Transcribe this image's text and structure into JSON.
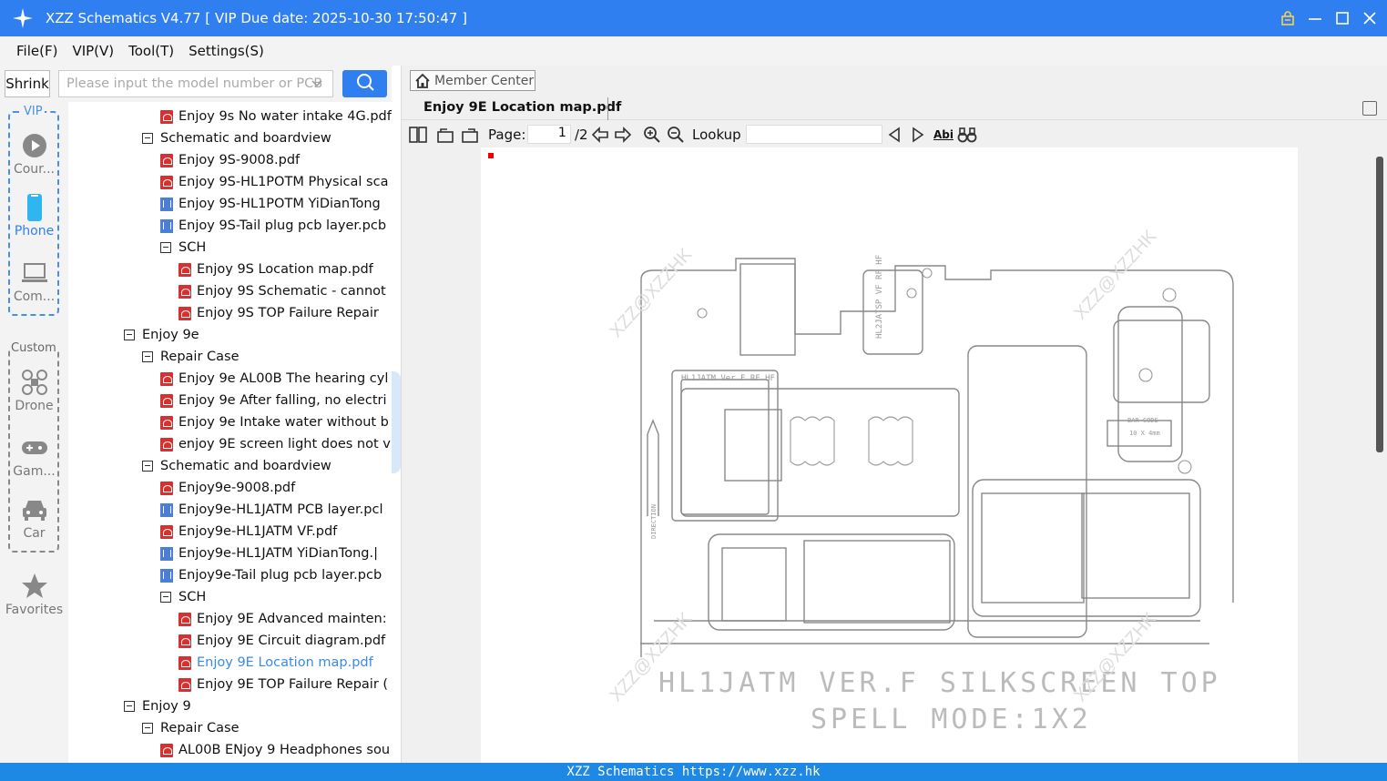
{
  "titlebar": {
    "title": "XZZ Schematics V4.77 [ VIP Due date: 2025-10-30 17:50:47 ]"
  },
  "menu": [
    "File(F)",
    "VIP(V)",
    "Tool(T)",
    "Settings(S)"
  ],
  "search": {
    "shrink_label": "Shrink",
    "placeholder": "Please input the model number or PCB"
  },
  "rail": {
    "vip_tag": "VIP",
    "custom_tag": "Custom",
    "items": [
      {
        "label": "Cour...",
        "icon": "play-icon"
      },
      {
        "label": "Phone",
        "icon": "phone-icon"
      },
      {
        "label": "Com...",
        "icon": "laptop-icon"
      },
      {
        "label": "Drone",
        "icon": "drone-icon"
      },
      {
        "label": "Gam...",
        "icon": "gamepad-icon"
      },
      {
        "label": "Car",
        "icon": "car-icon"
      },
      {
        "label": "Favorites",
        "icon": "star-icon"
      }
    ]
  },
  "tree": [
    {
      "label": "Enjoy 9s No water intake 4G.pdf",
      "type": "pdf"
    },
    {
      "label": "Schematic and boardview",
      "type": "folder"
    },
    {
      "label": "Enjoy 9S-9008.pdf",
      "type": "pdf"
    },
    {
      "label": "Enjoy 9S-HL1POTM Physical sca",
      "type": "pdf"
    },
    {
      "label": "Enjoy 9S-HL1POTM YiDianTong",
      "type": "pcb"
    },
    {
      "label": "Enjoy 9S-Tail plug pcb layer.pcb",
      "type": "pcb"
    },
    {
      "label": "SCH",
      "type": "folder"
    },
    {
      "label": "Enjoy 9S Location map.pdf",
      "type": "pdf"
    },
    {
      "label": "Enjoy 9S Schematic - cannot",
      "type": "pdf"
    },
    {
      "label": "Enjoy 9S TOP  Failure Repair",
      "type": "pdf"
    },
    {
      "label": "Enjoy 9e",
      "type": "folder"
    },
    {
      "label": "Repair Case",
      "type": "folder"
    },
    {
      "label": "Enjoy 9e AL00B The hearing cyl",
      "type": "pdf"
    },
    {
      "label": "Enjoy 9e After falling, no electri",
      "type": "pdf"
    },
    {
      "label": "Enjoy 9e Intake water without b",
      "type": "pdf"
    },
    {
      "label": "enjoy 9E screen light does not v",
      "type": "pdf"
    },
    {
      "label": "Schematic and boardview",
      "type": "folder"
    },
    {
      "label": "Enjoy9e-9008.pdf",
      "type": "pdf"
    },
    {
      "label": "Enjoy9e-HL1JATM PCB layer.pcl",
      "type": "pcb"
    },
    {
      "label": "Enjoy9e-HL1JATM VF.pdf",
      "type": "pdf"
    },
    {
      "label": "Enjoy9e-HL1JATM YiDianTong.|",
      "type": "pcb"
    },
    {
      "label": "Enjoy9e-Tail plug pcb layer.pcb",
      "type": "pcb"
    },
    {
      "label": "SCH",
      "type": "folder"
    },
    {
      "label": "Enjoy 9E Advanced mainten:",
      "type": "pdf"
    },
    {
      "label": "Enjoy 9E Circuit diagram.pdf",
      "type": "pdf"
    },
    {
      "label": "Enjoy 9E Location map.pdf",
      "type": "pdf"
    },
    {
      "label": "Enjoy 9E TOP Failure Repair (",
      "type": "pdf"
    },
    {
      "label": "Enjoy 9",
      "type": "folder"
    },
    {
      "label": "Repair Case",
      "type": "folder"
    },
    {
      "label": "AL00B ENjoy 9 Headphones sou",
      "type": "pdf"
    }
  ],
  "viewer": {
    "member_center": "Member Center",
    "tab_title": "Enjoy 9E Location map.pdf",
    "page_label": "Page:",
    "page_value": "1",
    "page_total": "/2",
    "lookup_label": "Lookup",
    "abi": "Abi",
    "silkscreen_line1": "HL1JATM VER.F SILKSCREEN TOP",
    "silkscreen_line2": "SPELL MODE:1X2",
    "board_label": "HL1JATM Ver.F RF HF",
    "bar_code_label": "BAR CODE",
    "bar_code_size": "10 X 4mm",
    "direction_label": "DIRECTION",
    "rf_label": "HL2JATSP VF RF HF",
    "watermark": "XZZ@XZZHK"
  },
  "footer": {
    "text": "XZZ Schematics https://www.xzz.hk"
  },
  "colors": {
    "accent": "#2f7ff0",
    "footer": "#1e88e5",
    "pdf": "#d63031"
  }
}
